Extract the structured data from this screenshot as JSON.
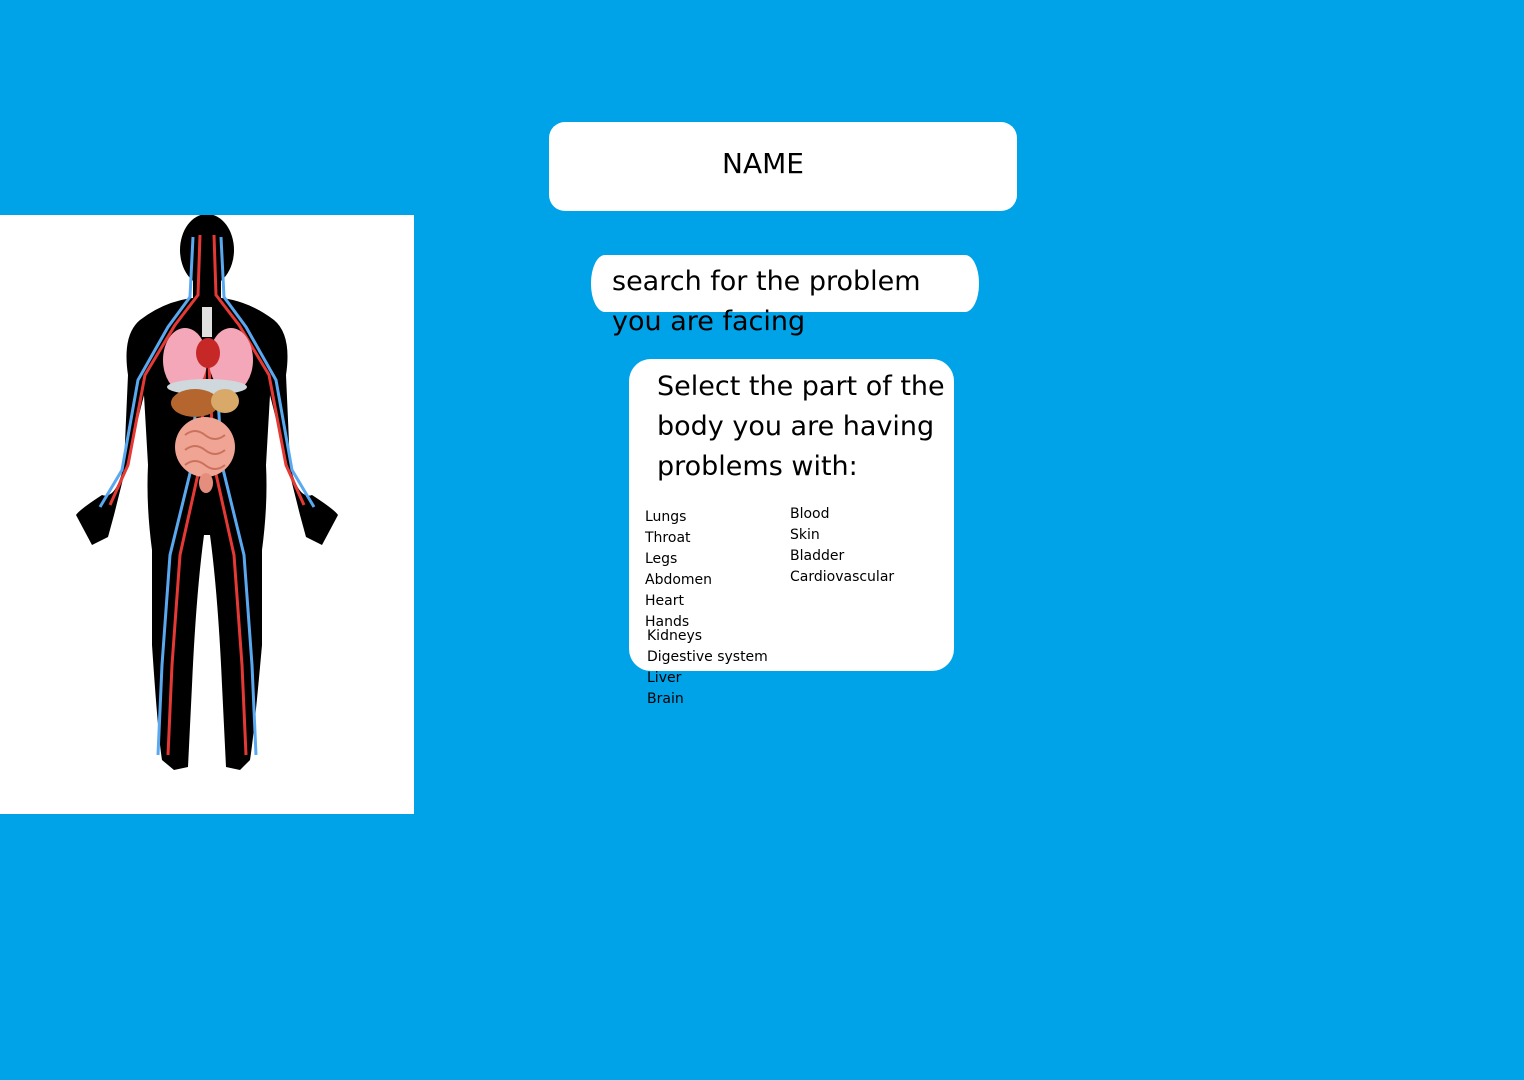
{
  "colors": {
    "background": "#00a2e8",
    "panel": "#ffffff",
    "text": "#000000"
  },
  "name_field": {
    "label": "NAME"
  },
  "search": {
    "placeholder": "search for the problem you are facing"
  },
  "body_select": {
    "prompt": "Select the part of the body you are having problems with:",
    "parts_column_1": [
      "Lungs",
      "Throat",
      "Legs",
      "Abdomen",
      "Heart",
      "Hands"
    ],
    "parts_column_1b": [
      "Kidneys",
      "Digestive system",
      "Liver",
      "Brain"
    ],
    "parts_column_2": [
      "Blood",
      "Skin",
      "Bladder",
      "Cardiovascular"
    ]
  },
  "illustration": {
    "icon": "human-anatomy-icon"
  }
}
